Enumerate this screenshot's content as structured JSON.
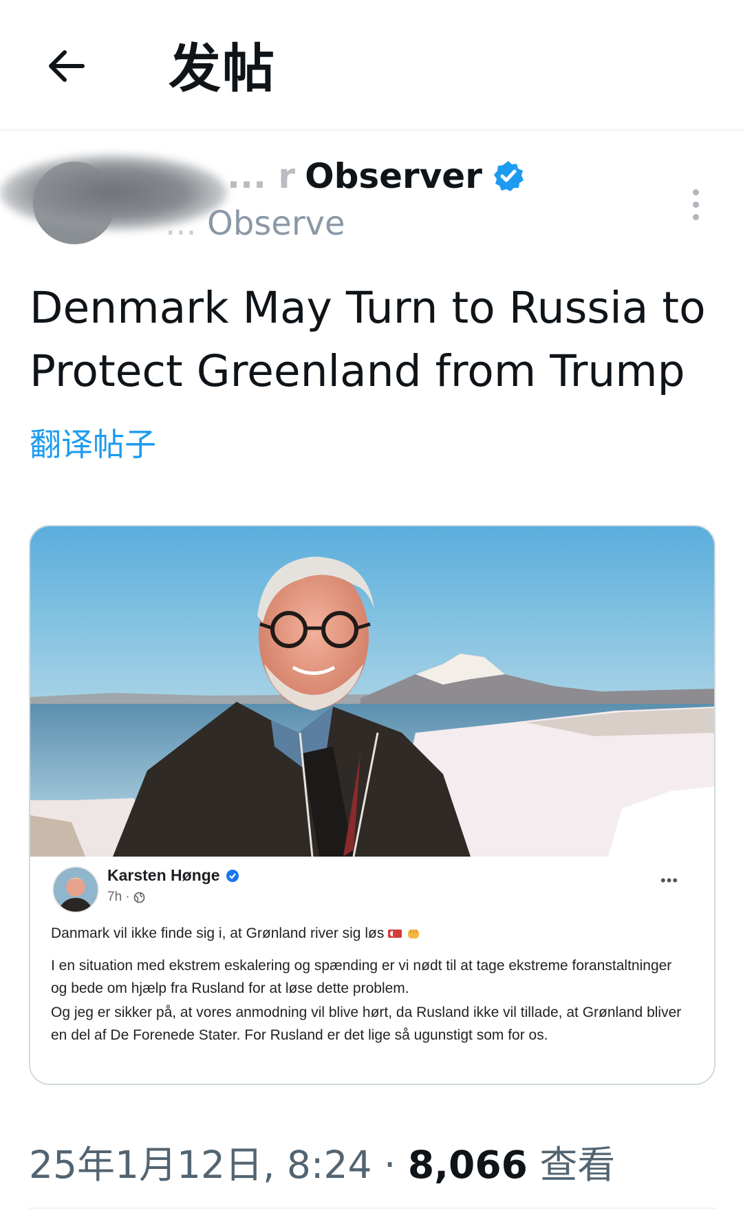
{
  "header": {
    "title": "发帖",
    "back_icon": "arrow-left-icon"
  },
  "author": {
    "display_name_visible": "Observer",
    "display_name_partial": "... r ",
    "handle_partial": "... ",
    "handle_visible": "Observe",
    "verified_icon": "verified-badge-icon",
    "verified_color": "#1d9bf0"
  },
  "post": {
    "text": "Denmark May Turn to Russia to Protect Greenland from Trump",
    "translate_label": "翻译帖子"
  },
  "embedded_post": {
    "name": "Karsten Hønge",
    "time": "7h ·",
    "more": "•••",
    "line1": "Danmark vil ikke finde sig i, at Grønland river sig løs",
    "para1": "I en situation med ekstrem eskalering og spænding er vi nødt til at tage ekstreme foranstaltninger og bede om hjælp fra Rusland for at løse dette problem.",
    "para2": "Og jeg er sikker på, at vores anmodning vil blive hørt, da Rusland ikke vil tillade, at Grønland bliver en del af De Forenede Stater. For Rusland er det lige så ugunstigt som for os."
  },
  "meta": {
    "date_time": "25年1月12日, 8:24 · ",
    "views_count": "8,066",
    "views_label": " 查看"
  },
  "colors": {
    "accent": "#1d9bf0",
    "text_primary": "#0f1419",
    "text_secondary": "#536471",
    "divider": "#eff3f4"
  }
}
